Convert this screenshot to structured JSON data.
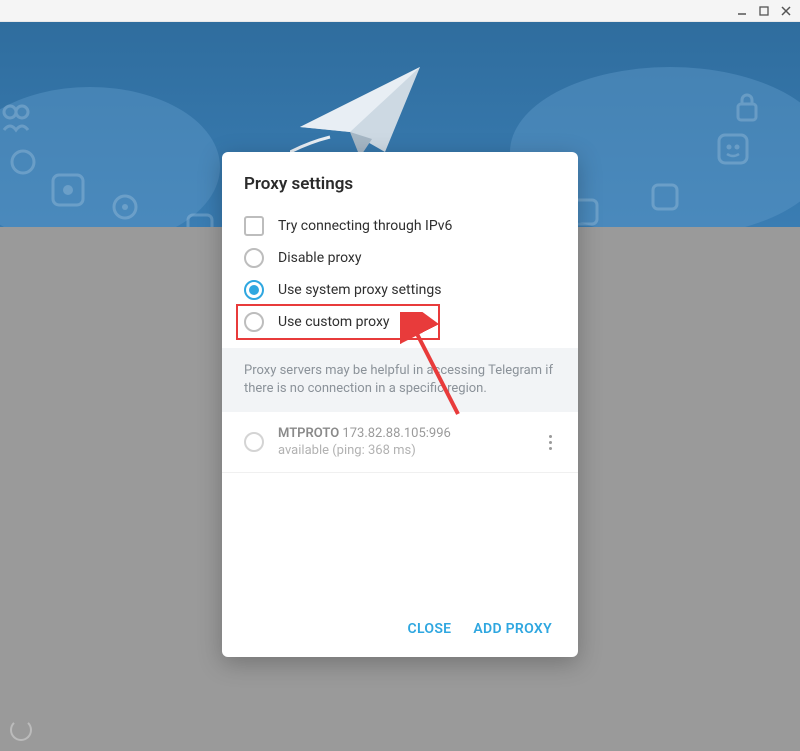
{
  "dialog": {
    "title": "Proxy settings",
    "options": {
      "ipv6": "Try connecting through IPv6",
      "disable": "Disable proxy",
      "system": "Use system proxy settings",
      "custom": "Use custom proxy"
    },
    "hint": "Proxy servers may be helpful in accessing Telegram if there is no connection in a specific region.",
    "proxy": {
      "protocol": "MTPROTO",
      "address": "173.82.88.105:996",
      "status": "available (ping: 368 ms)"
    },
    "actions": {
      "close": "CLOSE",
      "add": "ADD PROXY"
    }
  }
}
